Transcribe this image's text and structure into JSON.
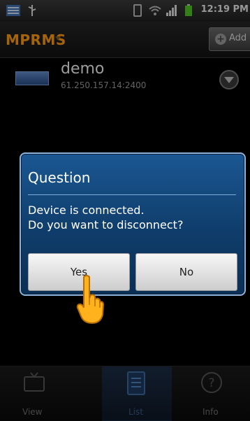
{
  "status_bar": {
    "time": "12:19 PM"
  },
  "app_bar": {
    "title": "MPRMS",
    "add_button_label": "Add"
  },
  "device": {
    "name": "demo",
    "address": "61.250.157.14:2400"
  },
  "dialog": {
    "title": "Question",
    "message_line1": "Device is connected.",
    "message_line2": "Do you want to disconnect?",
    "yes_label": "Yes",
    "no_label": "No"
  },
  "tabs": [
    {
      "label": "View",
      "icon": "tv-icon"
    },
    {
      "label": "List",
      "icon": "list-icon"
    },
    {
      "label": "Info",
      "icon": "question-icon"
    }
  ],
  "colors": {
    "accent": "#ff9a10",
    "dialog_bg": "#1b5792"
  }
}
